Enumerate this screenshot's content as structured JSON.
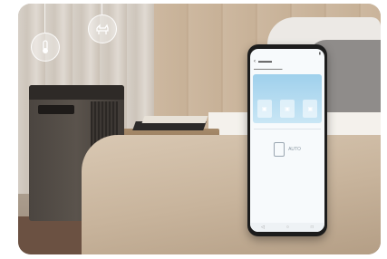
{
  "scene": {
    "description_icons": [
      "thermometer-icon",
      "pet-icon"
    ],
    "accent_sky": "#a9d6ef"
  },
  "phone_app": {
    "mode_label": "AUTO",
    "nav_icons": [
      "back-icon",
      "home-icon",
      "recents-icon"
    ]
  }
}
